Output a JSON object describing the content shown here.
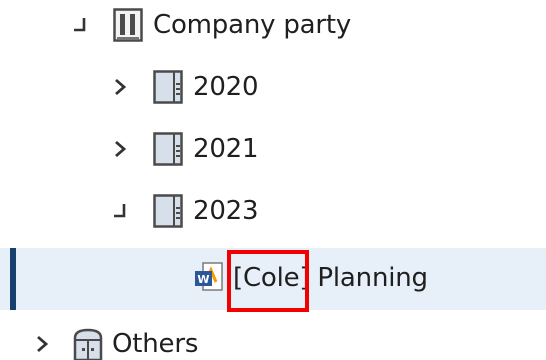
{
  "tree": {
    "items": [
      {
        "label": "Company party",
        "state": "expanded",
        "icon": "binder-icon"
      },
      {
        "label": "2020",
        "state": "collapsed",
        "icon": "folder-icon"
      },
      {
        "label": "2021",
        "state": "collapsed",
        "icon": "folder-icon"
      },
      {
        "label": "2023",
        "state": "expanded",
        "icon": "folder-icon"
      },
      {
        "label": "[Cole] Planning",
        "state": "selected",
        "icon": "word-document-icon"
      },
      {
        "label": "Others",
        "state": "collapsed",
        "icon": "cabinet-icon"
      }
    ]
  },
  "colors": {
    "selection_background": "#e7f0f9",
    "selection_bar": "#17416d",
    "highlight_border": "#f20000"
  }
}
